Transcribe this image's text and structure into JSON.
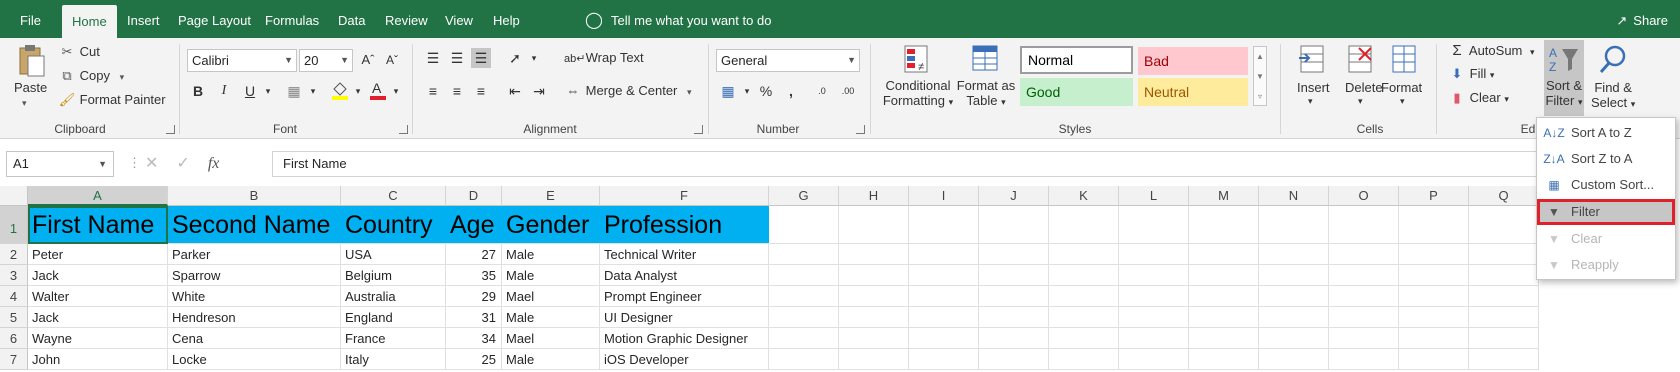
{
  "menubar": {
    "tabs": [
      {
        "label": "File"
      },
      {
        "label": "Home"
      },
      {
        "label": "Insert"
      },
      {
        "label": "Page Layout"
      },
      {
        "label": "Formulas"
      },
      {
        "label": "Data"
      },
      {
        "label": "Review"
      },
      {
        "label": "View"
      },
      {
        "label": "Help"
      }
    ],
    "tell_me": "Tell me what you want to do",
    "share": "Share"
  },
  "ribbon": {
    "clipboard": {
      "paste": "Paste",
      "cut": "Cut",
      "copy": "Copy",
      "format_painter": "Format Painter",
      "label": "Clipboard"
    },
    "font": {
      "name": "Calibri",
      "size": "20",
      "label": "Font"
    },
    "alignment": {
      "wrap_text": "Wrap Text",
      "merge_center": "Merge & Center",
      "label": "Alignment"
    },
    "number": {
      "format": "General",
      "label": "Number"
    },
    "styles": {
      "conditional": "Conditional",
      "formatting": "Formatting",
      "format_as": "Format as",
      "table": "Table",
      "normal": "Normal",
      "bad": "Bad",
      "good": "Good",
      "neutral": "Neutral",
      "label": "Styles"
    },
    "cells": {
      "insert": "Insert",
      "delete": "Delete",
      "format": "Format",
      "label": "Cells"
    },
    "editing": {
      "autosum": "AutoSum",
      "fill": "Fill",
      "clear": "Clear",
      "sort": "Sort &",
      "filter": "Filter",
      "find": "Find &",
      "select": "Select",
      "label": "Ed"
    }
  },
  "formula_bar": {
    "name_box": "A1",
    "formula": "First Name"
  },
  "sheet": {
    "columns": [
      "A",
      "B",
      "C",
      "D",
      "E",
      "F",
      "G",
      "H",
      "I",
      "J",
      "K",
      "L",
      "M",
      "N",
      "O",
      "P",
      "Q"
    ],
    "rows": [
      "1",
      "2",
      "3",
      "4",
      "5",
      "6",
      "7"
    ],
    "header": [
      "First Name",
      "Second Name",
      "Country",
      "Age",
      "Gender",
      "Profession"
    ],
    "data": [
      [
        "Peter",
        "Parker",
        "USA",
        "27",
        "Male",
        "Technical Writer"
      ],
      [
        "Jack",
        "Sparrow",
        "Belgium",
        "35",
        "Male",
        "Data Analyst"
      ],
      [
        "Walter",
        "White",
        "Australia",
        "29",
        "Mael",
        "Prompt Engineer"
      ],
      [
        "Jack",
        "Hendreson",
        "England",
        "31",
        "Male",
        "UI Designer"
      ],
      [
        "Wayne",
        "Cena",
        "France",
        "34",
        "Mael",
        "Motion Graphic Designer"
      ],
      [
        "John",
        "Locke",
        "Italy",
        "25",
        "Male",
        "iOS Developer"
      ]
    ]
  },
  "sort_menu": {
    "items": [
      {
        "label": "Sort A to Z"
      },
      {
        "label": "Sort Z to A"
      },
      {
        "label": "Custom Sort..."
      },
      {
        "label": "Filter"
      },
      {
        "label": "Clear"
      },
      {
        "label": "Reapply"
      }
    ]
  },
  "colors": {
    "brand": "#217346",
    "header_fill": "#00b0f0",
    "highlight": "#e0202a"
  }
}
